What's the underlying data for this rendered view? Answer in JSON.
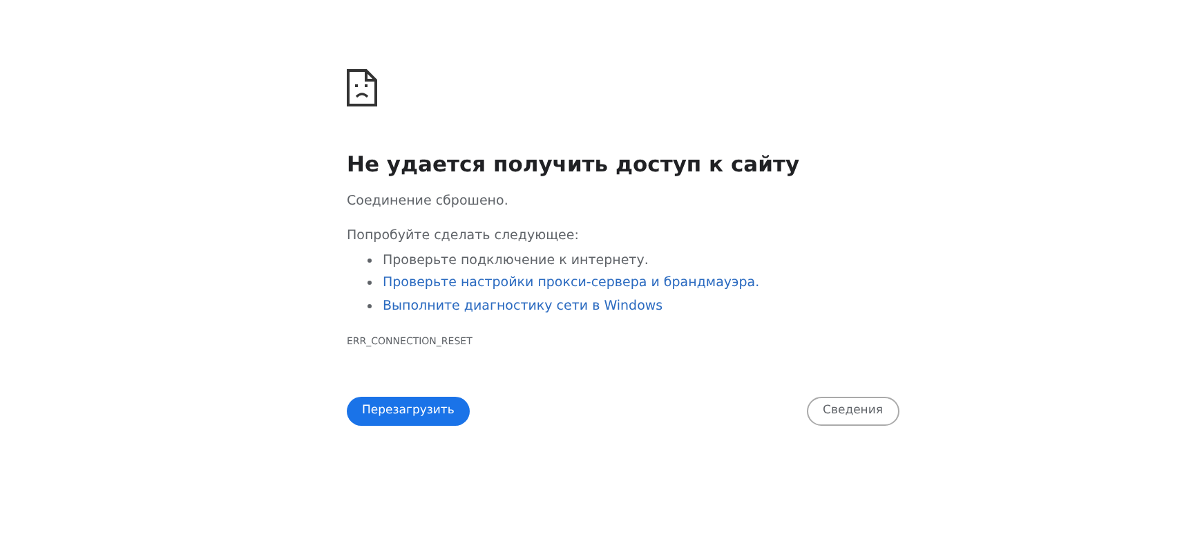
{
  "title": "Не удается получить доступ к сайту",
  "message": "Соединение сброшено.",
  "suggestions_heading": "Попробуйте сделать следующее:",
  "suggestions": [
    {
      "kind": "text",
      "text": "Проверьте подключение к интернету."
    },
    {
      "kind": "link",
      "text": "Проверьте настройки прокси-сервера и брандмауэра."
    },
    {
      "kind": "link",
      "text": "Выполните диагностику сети в Windows"
    }
  ],
  "error_code": "ERR_CONNECTION_RESET",
  "buttons": {
    "reload": "Перезагрузить",
    "details": "Сведения"
  }
}
